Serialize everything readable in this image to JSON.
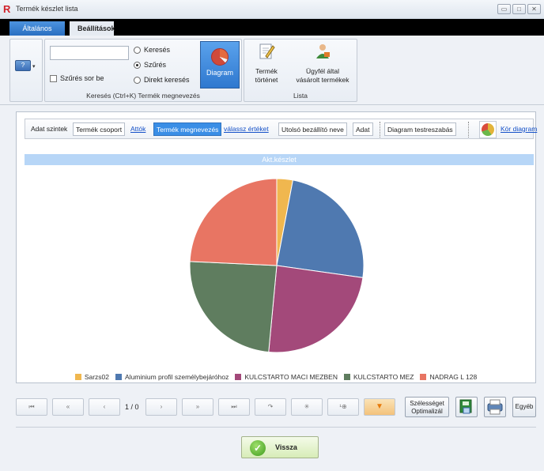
{
  "window": {
    "title": "Termék készlet lista",
    "logo": "R",
    "minimize_glyph": "▭",
    "maximize_glyph": "□",
    "close_glyph": "✕"
  },
  "tabs": [
    {
      "label": "Általános",
      "active": true
    },
    {
      "label": "Beállítások",
      "active": false
    }
  ],
  "ribbon": {
    "help_glyph": "?",
    "help_dropdown_glyph": "▾",
    "search_value": "",
    "filter_checkbox_label": "Szűrés sor be",
    "radios": [
      {
        "label": "Keresés",
        "selected": false
      },
      {
        "label": "Szűrés",
        "selected": true
      },
      {
        "label": "Direkt keresés",
        "selected": false
      }
    ],
    "diagram_label": "Diagram",
    "search_group_label": "Keresés (Ctrl+K) Termék megnevezés",
    "list_group_label": "Lista",
    "history_line1": "Termék",
    "history_line2": "történet",
    "customer_line1": "Ügyfél által",
    "customer_line2": "vásárolt termékek"
  },
  "toolbar": {
    "prefix": "Adat szintek",
    "group": "Termék csoport",
    "group_link": "Attók",
    "name": "Termék megnevezés",
    "name_link": "válassz értéket",
    "supplier": "Utolsó bezállító neve",
    "data": "Adat",
    "customize": "Diagram testreszabás",
    "pie_link": "Kör diagram"
  },
  "chart_data": {
    "type": "pie",
    "title": "Akt.készlet",
    "labels": [
      "Sarzs02",
      "Aluminium profil személybejáróhoz",
      "KULCSTARTO MACI MEZBEN",
      "KULCSTARTO MEZ",
      "NADRAG L 128"
    ],
    "values": [
      3,
      24.5,
      24.5,
      24.5,
      24.5
    ],
    "colors": [
      "#f0b74f",
      "#4f79b0",
      "#a3497a",
      "#5f7d5f",
      "#e87563"
    ],
    "legend_position": "bottom"
  },
  "navbar": {
    "first": "⏮",
    "prev_page": "«",
    "prev": "‹",
    "page": "1 / 0",
    "next": "›",
    "next_page": "»",
    "last": "⏭",
    "refresh": "↷",
    "add": "✳",
    "find": "¹⊕",
    "dropdown": "▼",
    "optimize_line1": "Szélességet",
    "optimize_line2": "Optimalizál",
    "other": "Egyéb"
  },
  "back_label": "Vissza",
  "back_glyph": "✓"
}
